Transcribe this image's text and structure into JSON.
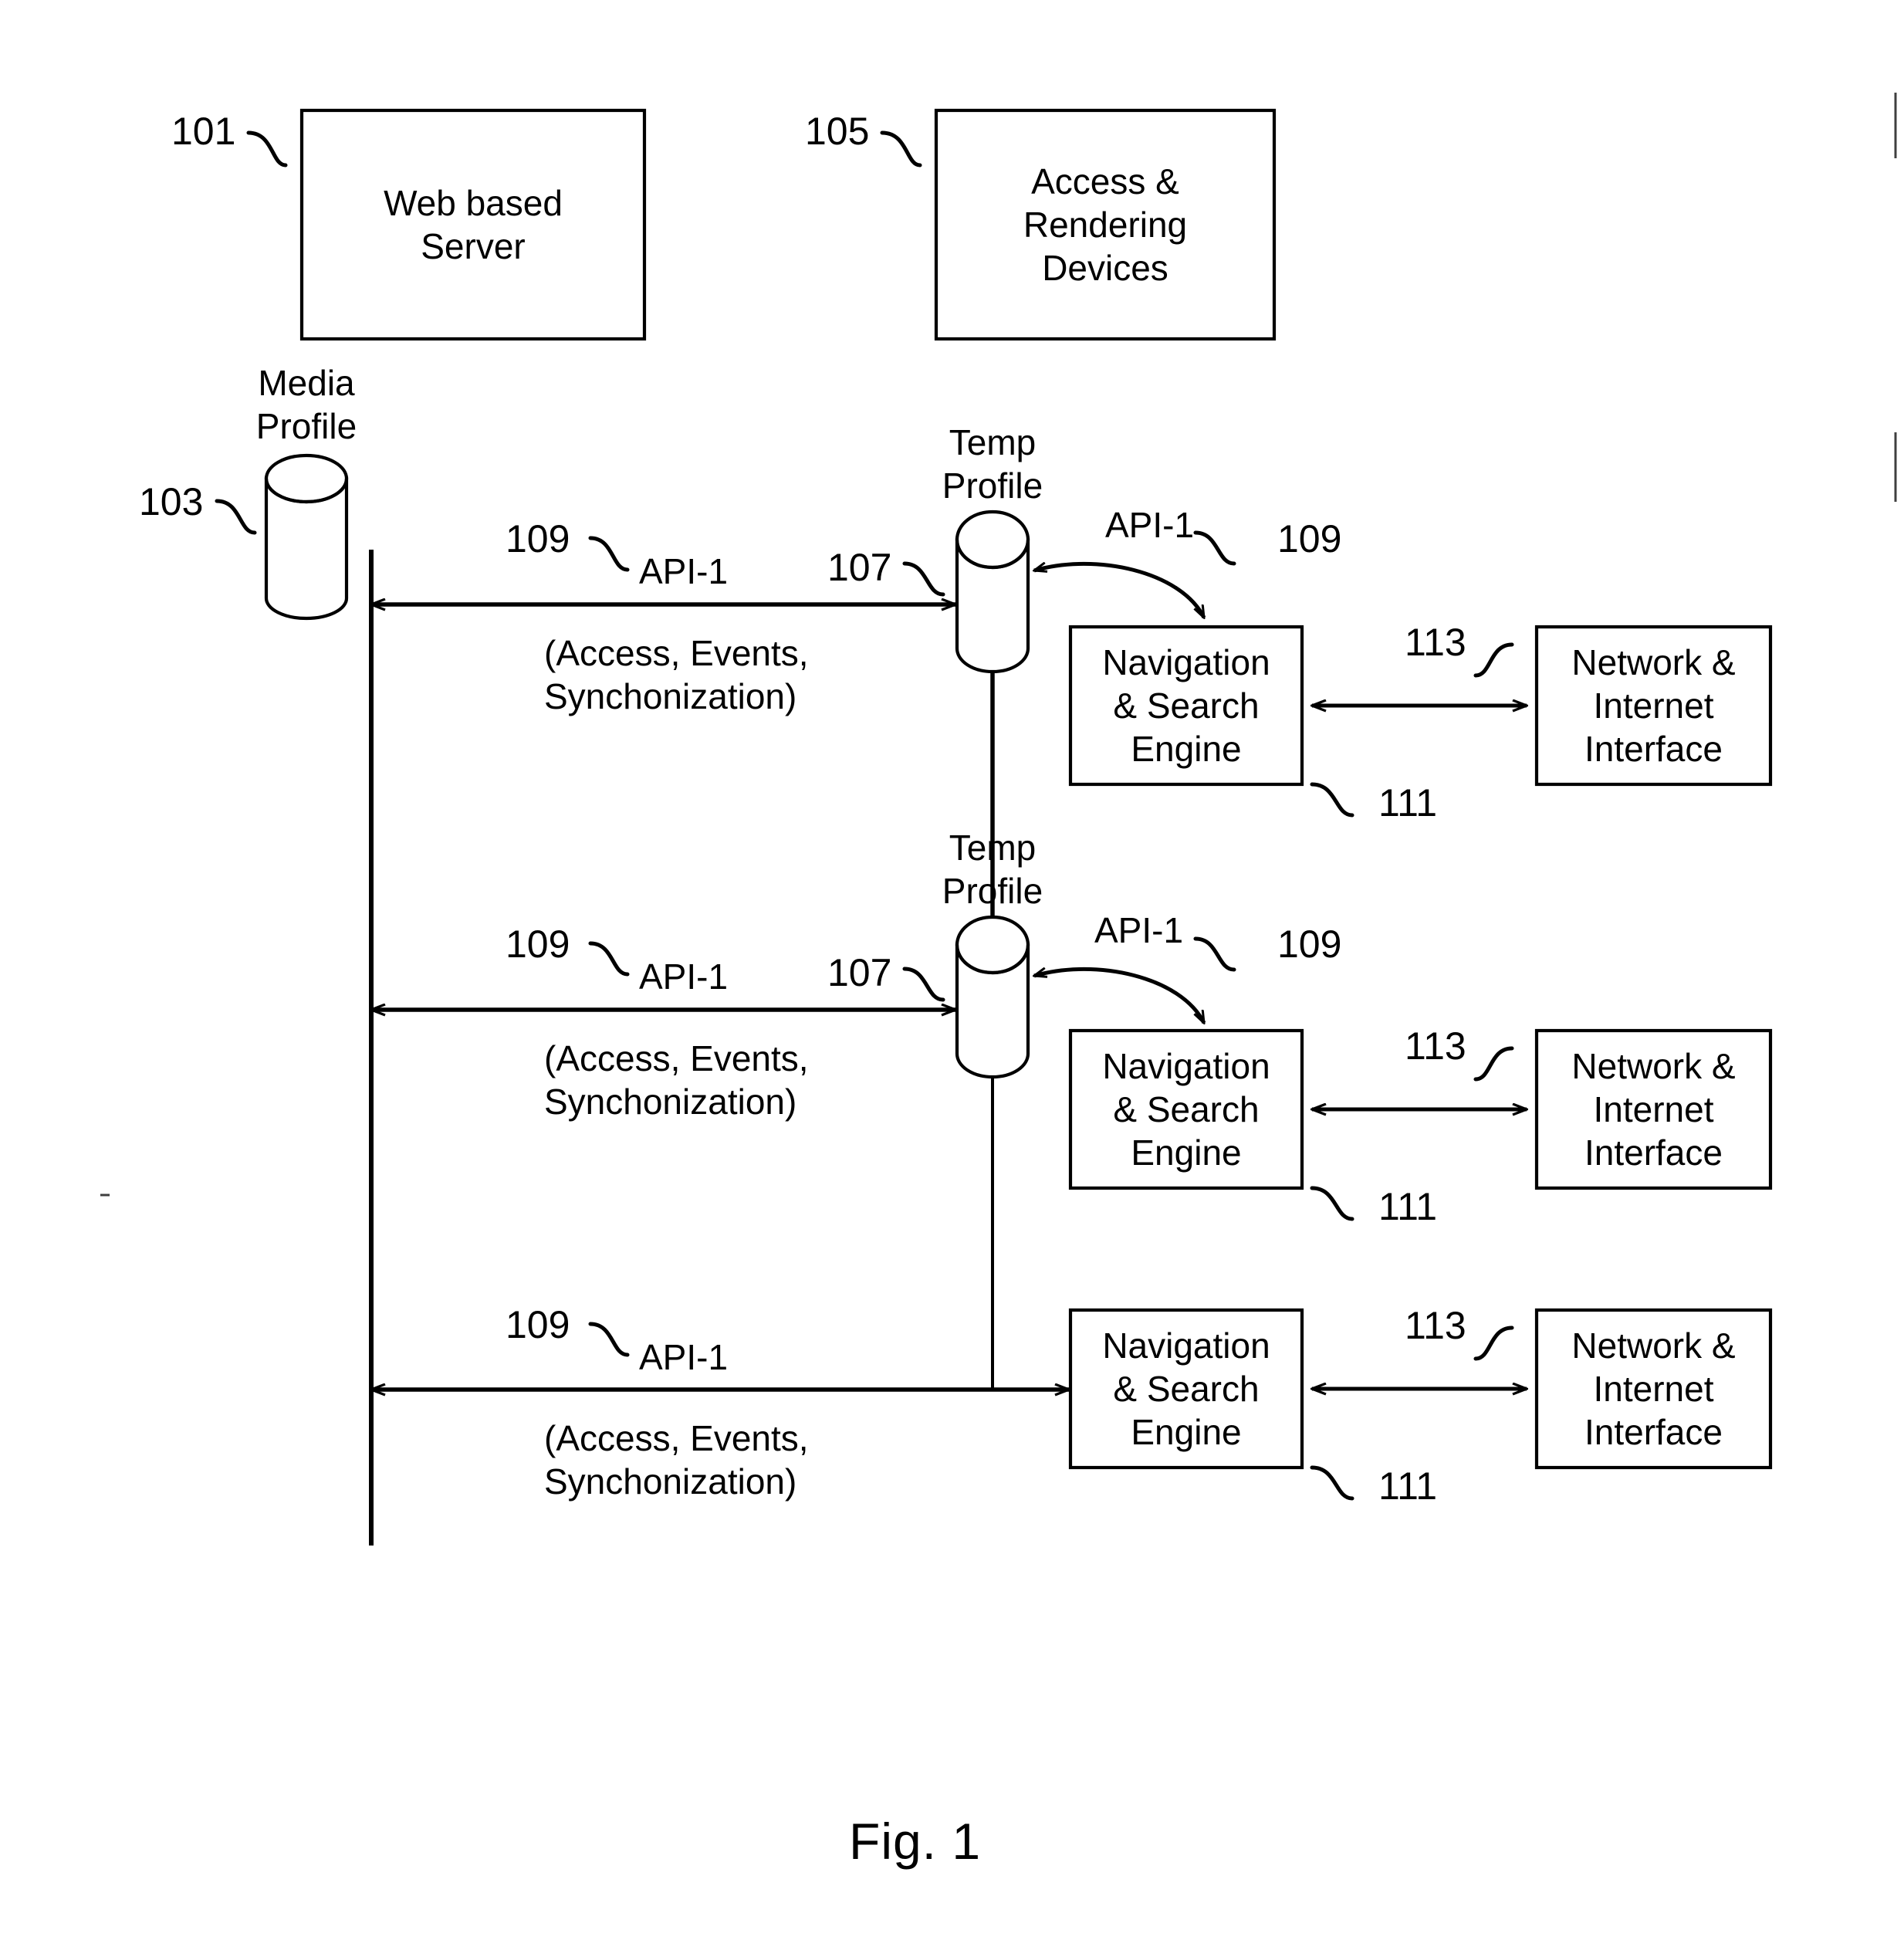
{
  "figure": {
    "caption": "Fig. 1",
    "page_edge_marks": true
  },
  "blocks": {
    "web_based_server": {
      "label": "Web based\nServer",
      "ref": "101"
    },
    "access_rendering_devices": {
      "label": "Access &\nRendering\nDevices",
      "ref": "105"
    },
    "media_profile": {
      "label": "Media\nProfile",
      "ref": "103",
      "shape": "cylinder"
    },
    "temp_profile_1": {
      "label": "Temp\nProfile",
      "ref": "107",
      "shape": "cylinder"
    },
    "temp_profile_2": {
      "label": "Temp\nProfile",
      "ref": "107",
      "shape": "cylinder"
    },
    "nav_search_1": {
      "label": "Navigation\n& Search\nEngine",
      "ref": "111"
    },
    "nav_search_2": {
      "label": "Navigation\n& Search\nEngine",
      "ref": "111"
    },
    "nav_search_3": {
      "label": "Navigation\n& Search\nEngine",
      "ref": "111"
    },
    "network_internet_1": {
      "label": "Network &\nInternet\nInterface",
      "ref": "113"
    },
    "network_internet_2": {
      "label": "Network &\nInternet\nInterface",
      "ref": "113"
    },
    "network_internet_3": {
      "label": "Network &\nInternet\nInterface",
      "ref": "113"
    }
  },
  "connections": {
    "api_row_1": {
      "ref": "109",
      "label": "API-1",
      "detail": "(Access, Events,\nSynchonization)"
    },
    "api_row_2": {
      "ref": "109",
      "label": "API-1",
      "detail": "(Access, Events,\nSynchonization)"
    },
    "api_row_3": {
      "ref": "109",
      "label": "API-1",
      "detail": "(Access, Events,\nSynchonization)"
    },
    "api_curve_1": {
      "ref": "109",
      "label": "API-1"
    },
    "api_curve_2": {
      "ref": "109",
      "label": "API-1"
    }
  },
  "colors": {
    "stroke": "#000000",
    "background": "#ffffff"
  }
}
